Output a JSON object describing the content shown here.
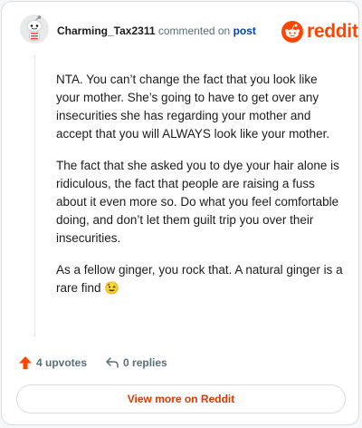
{
  "header": {
    "username": "Charming_Tax2311",
    "action_text": "commented on",
    "post_link": "post",
    "logo_text": "reddit"
  },
  "comment": {
    "paragraphs": [
      "NTA. You can’t change the fact that you look like your mother. She’s going to have to get over any insecurities she has regarding your mother and accept that you will ALWAYS look like your mother.",
      "The fact that she asked you to dye your hair alone is ridiculous, the fact that people are raising a fuss about it even more so. Do what you feel comfortable doing, and don’t let them guilt trip you over their insecurities.",
      "As a fellow ginger, you rock that. A natural ginger is a rare find 😉"
    ]
  },
  "actions": {
    "upvotes_label": "4 upvotes",
    "replies_label": "0 replies"
  },
  "footer": {
    "view_more_label": "View more on Reddit"
  },
  "colors": {
    "brand": "#ff4500",
    "link": "#0045ac",
    "muted": "#576f76",
    "view_more": "#d93a00"
  },
  "icons": [
    "avatar-snoo",
    "reddit-logo-icon",
    "upvote-arrow-icon",
    "reply-arrow-icon"
  ]
}
